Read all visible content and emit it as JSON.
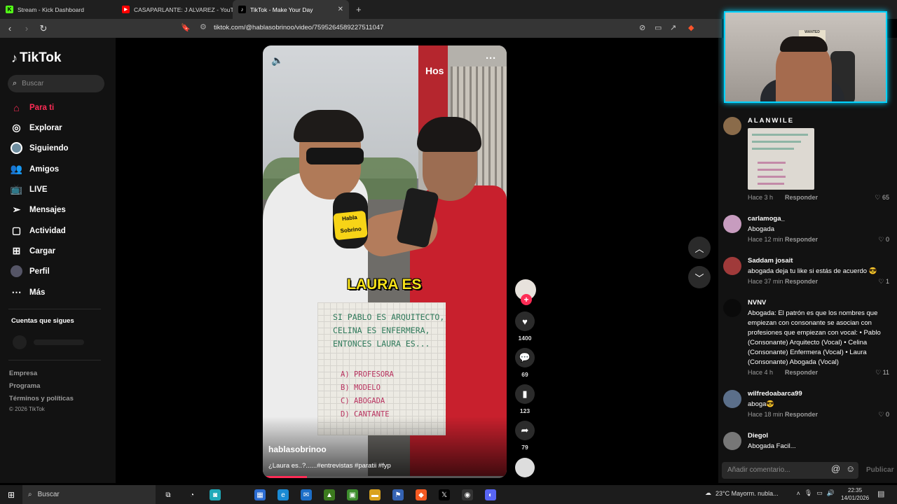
{
  "browser": {
    "tabs": [
      {
        "title": "Stream - Kick Dashboard",
        "favicon": "kick-icon",
        "color": "#53fc18"
      },
      {
        "title": "CASAPARLANTE: J ALVAREZ - YouTub",
        "favicon": "youtube-icon",
        "color": "#ff0000"
      },
      {
        "title": "TikTok - Make Your Day",
        "favicon": "tiktok-icon",
        "color": "#000000"
      }
    ],
    "url": "tiktok.com/@hablasobrinoo/video/7595264589227511047"
  },
  "sidebar": {
    "logo_text": "TikTok",
    "search_placeholder": "Buscar",
    "nav": [
      {
        "label": "Para ti",
        "icon": "home-icon",
        "active": true
      },
      {
        "label": "Explorar",
        "icon": "compass-icon"
      },
      {
        "label": "Siguiendo",
        "icon": "following-avatar-icon"
      },
      {
        "label": "Amigos",
        "icon": "friends-icon"
      },
      {
        "label": "LIVE",
        "icon": "live-icon"
      },
      {
        "label": "Mensajes",
        "icon": "messages-icon"
      },
      {
        "label": "Actividad",
        "icon": "activity-icon"
      },
      {
        "label": "Cargar",
        "icon": "upload-icon"
      },
      {
        "label": "Perfil",
        "icon": "profile-icon"
      },
      {
        "label": "Más",
        "icon": "more-icon"
      }
    ],
    "following_heading": "Cuentas que sigues",
    "footer_links": [
      "Empresa",
      "Programa",
      "Términos y políticas"
    ],
    "copyright": "© 2026 TikTok"
  },
  "video": {
    "author": "hablasobrinoo",
    "caption": "¿Laura es..?......#entrevistas #paratii #fyp",
    "overlay_text": "LAURA ES",
    "board_lines": [
      "SI PABLO ES ARQUITECTO,",
      "CELINA ES ENFERMERA,",
      "ENTONCES LAURA ES..."
    ],
    "board_options": [
      "A) PROFESORA",
      "B) MODELO",
      "C) ABOGADA",
      "D) CANTANTE"
    ],
    "mic_label": "Habla Sobrino",
    "building_sign": "Hos",
    "progress": 0.18
  },
  "actions": {
    "likes": "1400",
    "comments": "69",
    "saves": "123",
    "shares": "79"
  },
  "comments": [
    {
      "user": "ALANWILE",
      "text": "",
      "time": "Hace 3 h",
      "reply": "Responder",
      "likes": "65",
      "has_image": true
    },
    {
      "user": "carlamoga_",
      "text": "Abogada",
      "time": "Hace 12 min",
      "reply": "Responder",
      "likes": "0"
    },
    {
      "user": "Saddam josait",
      "text": "abogada deja tu like si estás de acuerdo 😎",
      "time": "Hace 37 min",
      "reply": "Responder",
      "likes": "1"
    },
    {
      "user": "NVNV",
      "text": "Abogada: El patrón es que los nombres que empiezan con consonante se asocian con profesiones que empiezan con vocal: • Pablo (Consonante) Arquitecto (Vocal) • Celina (Consonante) Enfermera (Vocal) • Laura (Consonante) Abogada (Vocal)",
      "time": "Hace 4 h",
      "reply": "Responder",
      "likes": "11"
    },
    {
      "user": "wilfredoabarca99",
      "text": "aboga😎",
      "time": "Hace 18 min",
      "reply": "Responder",
      "likes": "0"
    },
    {
      "user": "Diegol",
      "text": "Abogada Facil...",
      "time": "",
      "reply": "",
      "likes": ""
    }
  ],
  "comment_input": {
    "placeholder": "Añadir comentario...",
    "publish": "Publicar"
  },
  "webcam": {
    "poster": "WANTED"
  },
  "taskbar": {
    "search": "Buscar",
    "weather": "23°C  Mayorm. nubla...",
    "time": "22:35",
    "date": "14/01/2026"
  }
}
